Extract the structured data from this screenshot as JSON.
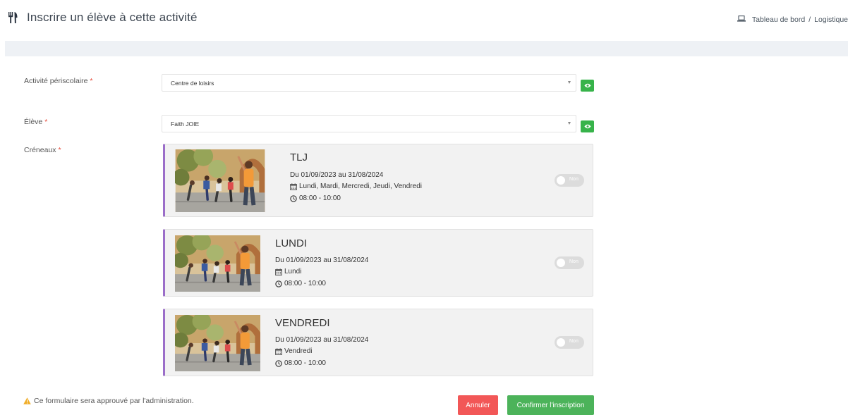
{
  "header": {
    "title": "Inscrire un élève à cette activité",
    "breadcrumb": {
      "items": [
        "Tableau de bord",
        "Logistique"
      ],
      "separator": "/"
    }
  },
  "form": {
    "activity": {
      "label": "Activité périscolaire",
      "required_mark": "*",
      "value": "Centre de loisirs"
    },
    "student": {
      "label": "Élève",
      "required_mark": "*",
      "value": "Faith JOIE"
    },
    "slots": {
      "label": "Créneaux",
      "required_mark": "*",
      "items": [
        {
          "title": "TLJ",
          "dates": "Du 01/09/2023 au 31/08/2024",
          "days": "Lundi, Mardi, Mercredi, Jeudi, Vendredi",
          "time": "08:00 - 10:00",
          "toggle_label": "Non"
        },
        {
          "title": "LUNDI",
          "dates": "Du 01/09/2023 au 31/08/2024",
          "days": "Lundi",
          "time": "08:00 - 10:00",
          "toggle_label": "Non"
        },
        {
          "title": "VENDREDI",
          "dates": "Du 01/09/2023 au 31/08/2024",
          "days": "Vendredi",
          "time": "08:00 - 10:00",
          "toggle_label": "Non"
        }
      ]
    }
  },
  "footer": {
    "note": "Ce formulaire sera approuvé par l'administration.",
    "cancel_label": "Annuler",
    "confirm_label": "Confirmer l'inscription"
  },
  "colors": {
    "accent_purple": "#9b6ec9",
    "eye_button_green": "#37b34a",
    "cancel_red": "#f25757",
    "confirm_green": "#4cb35a",
    "warning_yellow": "#f0ad28"
  },
  "icons": {
    "title": "utensils-icon",
    "breadcrumb": "laptop-icon",
    "select_action": "eye-icon",
    "days": "calendar-icon",
    "time": "clock-icon",
    "note": "warning-icon"
  }
}
